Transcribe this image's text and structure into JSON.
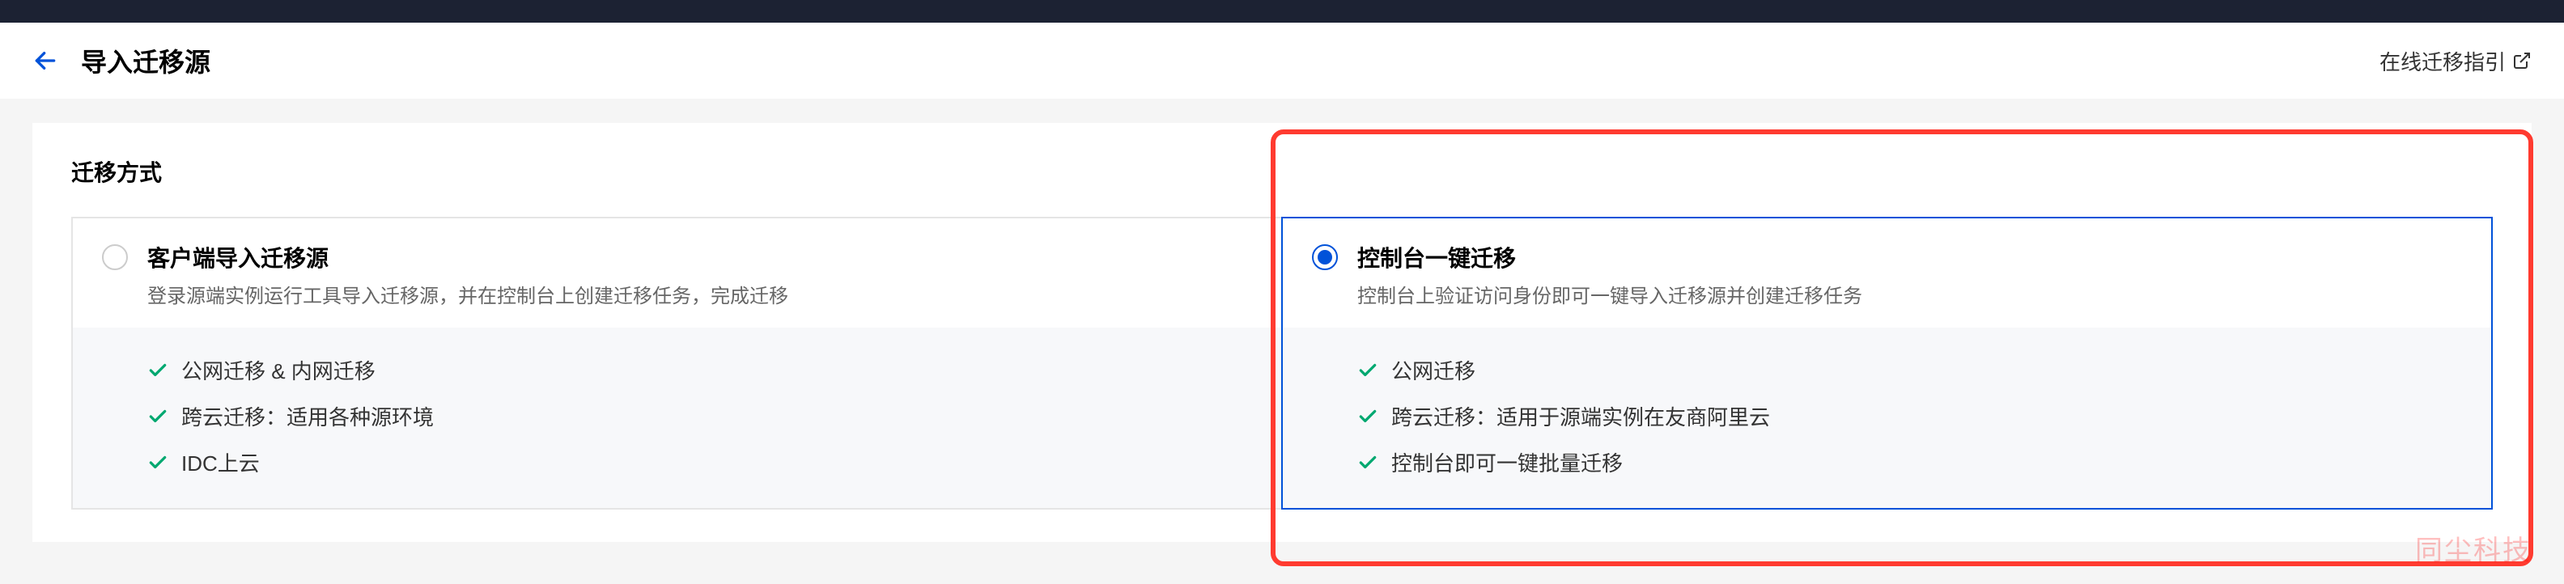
{
  "header": {
    "page_title": "导入迁移源",
    "guide_link_label": "在线迁移指引"
  },
  "section": {
    "title": "迁移方式"
  },
  "options": [
    {
      "title": "客户端导入迁移源",
      "desc": "登录源端实例运行工具导入迁移源，并在控制台上创建迁移任务，完成迁移",
      "features": [
        "公网迁移 & 内网迁移",
        "跨云迁移：适用各种源环境",
        "IDC上云"
      ],
      "selected": false
    },
    {
      "title": "控制台一键迁移",
      "desc": "控制台上验证访问身份即可一键导入迁移源并创建迁移任务",
      "features": [
        "公网迁移",
        "跨云迁移：适用于源端实例在友商阿里云",
        "控制台即可一键批量迁移"
      ],
      "selected": true
    }
  ],
  "watermark": "同尘科技"
}
